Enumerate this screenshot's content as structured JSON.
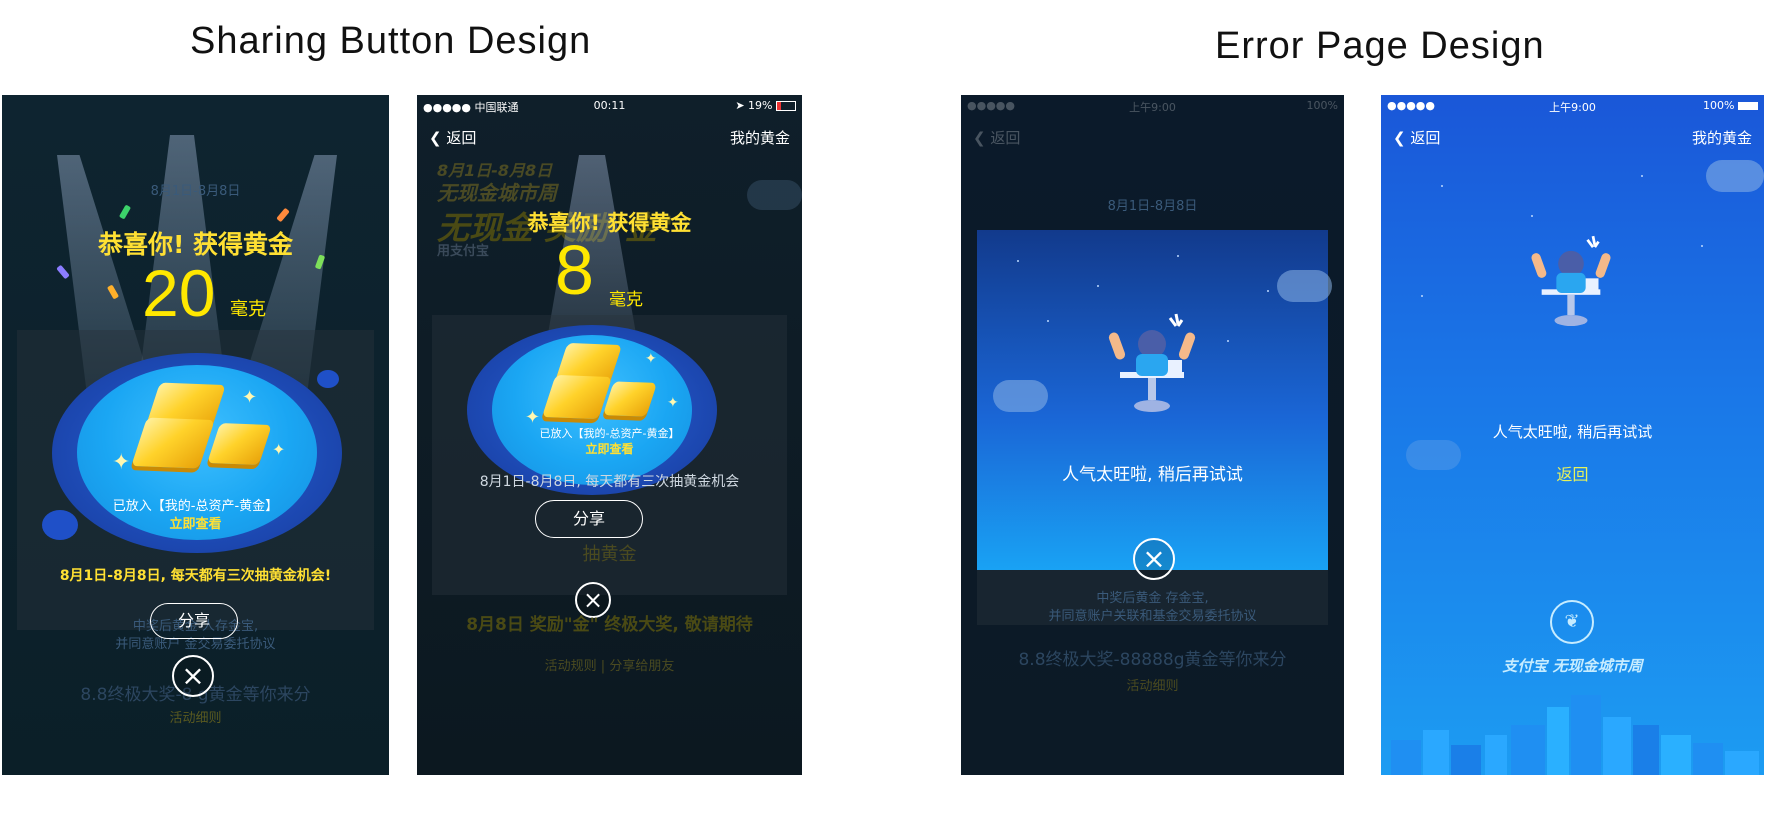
{
  "titles": {
    "left": "Sharing Button Design",
    "right": "Error Page Design"
  },
  "screen1": {
    "faded_title": "8月1日-8月8日",
    "congrats": "恭喜你! 获得黄金",
    "amount": "20",
    "unit": "毫克",
    "placed_text": "已放入【我的-总资产-黄金】",
    "view_link": "立即查看",
    "chance_text": "8月1日-8月8日, 每天都有三次抽黄金机会!",
    "share_label": "分享",
    "faint_line1": "中奖后黄金 人存金宝,",
    "faint_line2": "并同意账户 金交易委托协议",
    "faint_bottom": "8.8终极大奖-8 g黄金等你来分",
    "faint_rules": "活动细则",
    "close_icon": "×"
  },
  "screen2": {
    "status": {
      "carrier": "●●●●● 中国联通",
      "time": "00:11",
      "battery": "19%"
    },
    "nav": {
      "back": "返回",
      "title": "我的黄金"
    },
    "banner1": "8月1日-8月8日",
    "banner2": "无现金城市周",
    "banner3": "无现金 奖励\"金\"",
    "banner4": "用支付宝",
    "congrats": "恭喜你! 获得黄金",
    "amount": "8",
    "unit": "毫克",
    "placed_text": "已放入【我的-总资产-黄金】",
    "view_link": "立即查看",
    "chance_text": "8月1日-8月8日, 每天都有三次抽黄金机会",
    "share_label": "分享",
    "faint_draw": "抽黄金",
    "faint_bottom": "8月8日 奖励\"金\" 终极大奖, 敬请期待",
    "faint_rules": "活动规则  |  分享给朋友",
    "close_icon": "×"
  },
  "screen3": {
    "status": {
      "time": "上午9:00",
      "battery": "100%"
    },
    "nav": {
      "back": "返回"
    },
    "faint_top": "8月1日-8月8日",
    "error_message": "人气太旺啦, 稍后再试试",
    "faint_line1": "中奖后黄金 存金宝,",
    "faint_line2": "并同意账户关联和基金交易委托协议",
    "faint_bottom": "8.8终极大奖-88888g黄金等你来分",
    "faint_rules": "活动细则",
    "close_icon": "×"
  },
  "screen4": {
    "status": {
      "signal": "●●●●●",
      "time": "上午9:00",
      "battery": "100%"
    },
    "nav": {
      "back": "返回",
      "title": "我的黄金"
    },
    "error_message": "人气太旺啦, 稍后再试试",
    "back_link": "返回",
    "brand": "支付宝  无现金城市周"
  },
  "colors": {
    "gold_text": "#ffe033",
    "platter": "#1aa6f3",
    "error_bg": "#1a78e8",
    "link_yellow": "#e7f25a"
  }
}
